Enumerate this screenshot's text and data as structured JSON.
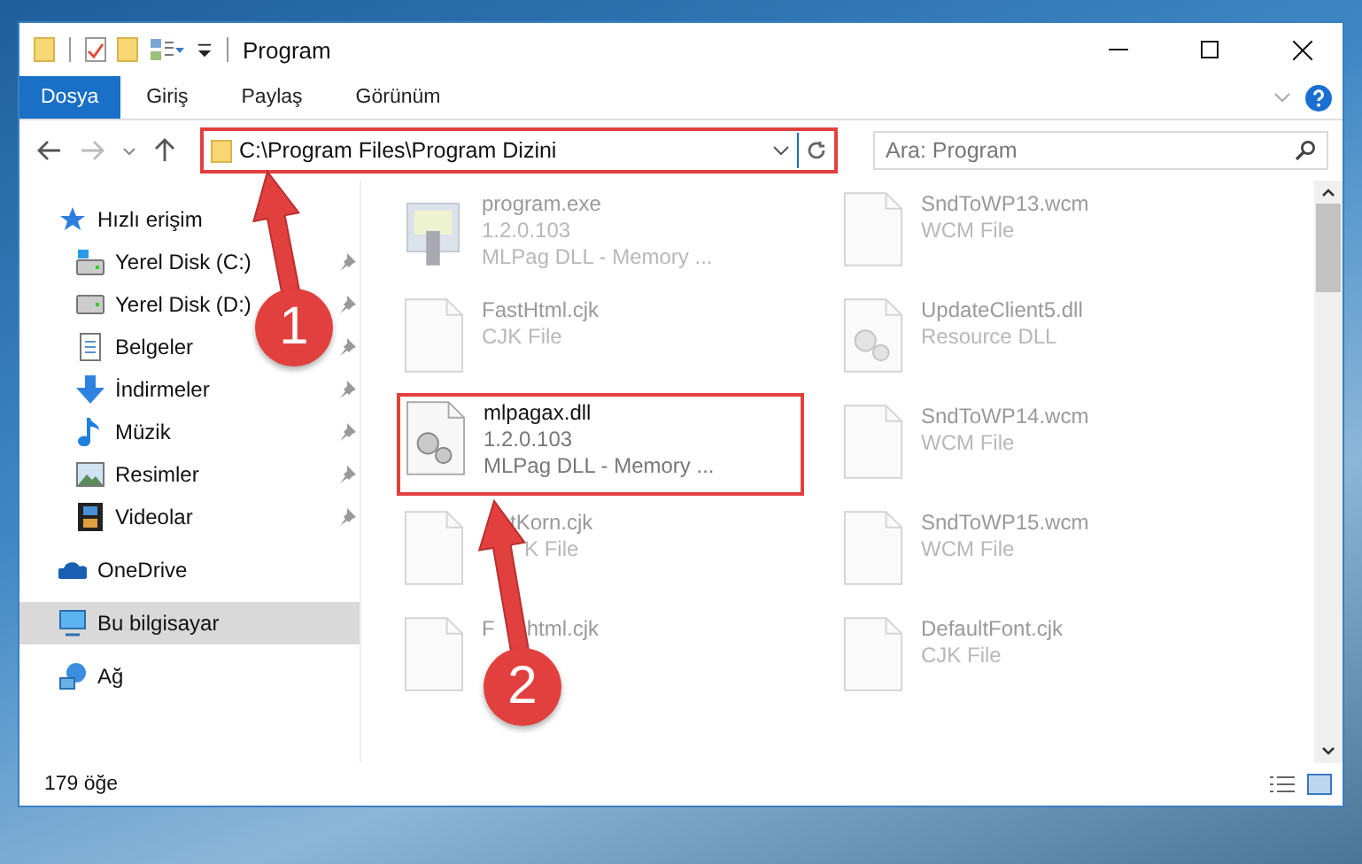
{
  "window": {
    "title": "Program"
  },
  "ribbon": {
    "tabs": [
      {
        "label": "Dosya",
        "selected": true
      },
      {
        "label": "Giriş",
        "selected": false
      },
      {
        "label": "Paylaş",
        "selected": false
      },
      {
        "label": "Görünüm",
        "selected": false
      }
    ]
  },
  "address_bar": {
    "path": "C:\\Program Files\\Program Dizini",
    "highlighted": true
  },
  "search": {
    "placeholder": "Ara: Program"
  },
  "sidebar": {
    "items": [
      {
        "label": "Hızlı erişim",
        "kind": "star",
        "selected": false,
        "children": [
          {
            "label": "Yerel Disk (C:)",
            "kind": "system-drive",
            "pinned": true
          },
          {
            "label": "Yerel Disk (D:)",
            "kind": "drive",
            "pinned": true
          },
          {
            "label": "Belgeler",
            "kind": "documents",
            "pinned": true
          },
          {
            "label": "İndirmeler",
            "kind": "downloads",
            "pinned": true
          },
          {
            "label": "Müzik",
            "kind": "music",
            "pinned": true
          },
          {
            "label": "Resimler",
            "kind": "pictures",
            "pinned": true
          },
          {
            "label": "Videolar",
            "kind": "videos",
            "pinned": true
          }
        ]
      },
      {
        "label": "OneDrive",
        "kind": "cloud",
        "selected": false
      },
      {
        "label": "Bu bilgisayar",
        "kind": "computer",
        "selected": true
      },
      {
        "label": "Ağ",
        "kind": "network",
        "selected": false
      }
    ]
  },
  "files": {
    "columns": [
      [
        {
          "name": "program.exe",
          "lines": [
            "1.2.0.103",
            "MLPag DLL - Memory ..."
          ],
          "kind": "application",
          "faded": true
        },
        {
          "name": "FastHtml.cjk",
          "lines": [
            "CJK File"
          ],
          "kind": "file",
          "faded": true
        },
        {
          "name": "mlpagax.dll",
          "lines": [
            "1.2.0.103",
            "MLPag DLL - Memory ..."
          ],
          "kind": "library",
          "faded": false,
          "highlighted": true
        },
        {
          "name": "tKorn.cjk",
          "lines": [
            "K File"
          ],
          "kind": "file",
          "faded": true,
          "covered": true
        },
        {
          "name": "F",
          "name_after": "html.cjk",
          "kind": "file",
          "faded": true,
          "covered": true
        }
      ],
      [
        {
          "name": "SndToWP13.wcm",
          "lines": [
            "WCM File"
          ],
          "kind": "file",
          "faded": true
        },
        {
          "name": "UpdateClient5.dll",
          "lines": [
            "Resource DLL"
          ],
          "kind": "library",
          "faded": true
        },
        {
          "name": "SndToWP14.wcm",
          "lines": [
            "WCM File"
          ],
          "kind": "file",
          "faded": true
        },
        {
          "name": "SndToWP15.wcm",
          "lines": [
            "WCM File"
          ],
          "kind": "file",
          "faded": true
        },
        {
          "name": "DefaultFont.cjk",
          "lines": [
            "CJK File"
          ],
          "kind": "file",
          "faded": true
        }
      ]
    ]
  },
  "status_bar": {
    "count": "179 öğe"
  },
  "callouts": [
    {
      "number": "1"
    },
    {
      "number": "2"
    }
  ]
}
